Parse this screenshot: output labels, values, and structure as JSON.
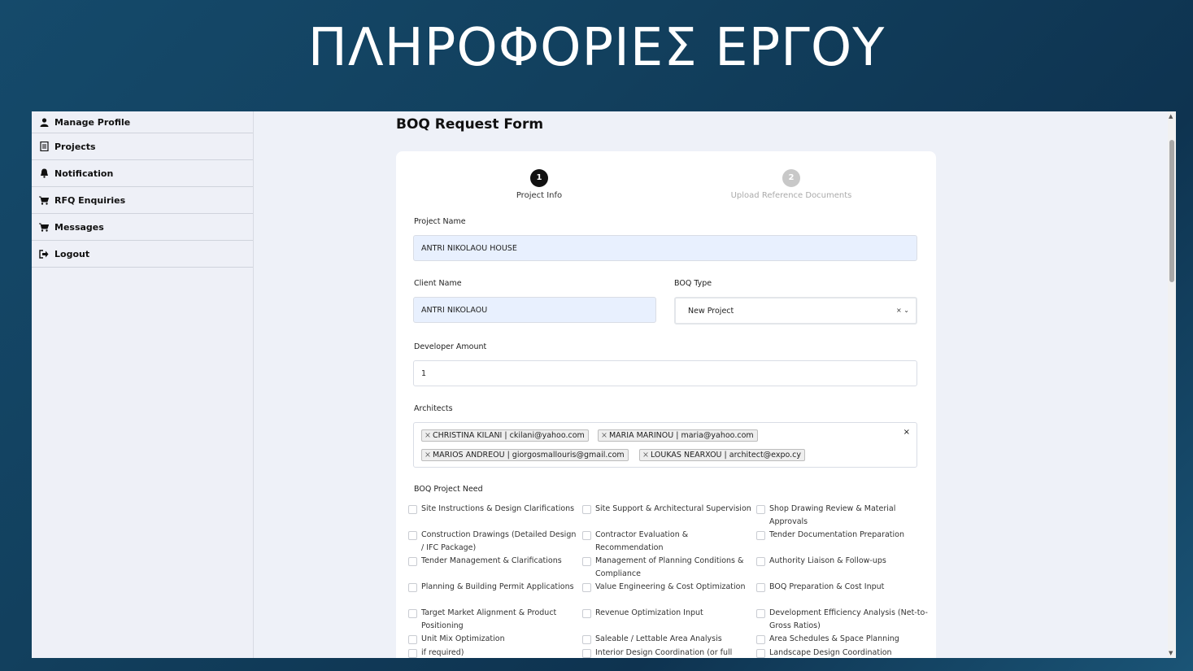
{
  "slide": {
    "title": "ΠΛΗΡΟΦΟΡΙΕΣ ΕΡΓΟΥ"
  },
  "sidebar": {
    "items": [
      {
        "label": "Manage Profile",
        "icon": "user-icon"
      },
      {
        "label": "Projects",
        "icon": "document-icon"
      },
      {
        "label": "Notification",
        "icon": "bell-icon"
      },
      {
        "label": "RFQ Enquiries",
        "icon": "cart-icon"
      },
      {
        "label": "Messages",
        "icon": "cart-icon"
      },
      {
        "label": "Logout",
        "icon": "logout-icon"
      }
    ]
  },
  "form": {
    "title": "BOQ Request Form",
    "steps": [
      {
        "number": "1",
        "label": "Project Info",
        "active": true
      },
      {
        "number": "2",
        "label": "Upload Reference Documents",
        "active": false
      }
    ],
    "project_name": {
      "label": "Project Name",
      "value": "ANTRI NIKOLAOU HOUSE"
    },
    "client_name": {
      "label": "Client Name",
      "value": "ANTRI NIKOLAOU"
    },
    "boq_type": {
      "label": "BOQ Type",
      "value": "New Project"
    },
    "developer_amount": {
      "label": "Developer Amount",
      "value": "1"
    },
    "architects": {
      "label": "Architects",
      "tags": [
        "CHRISTINA KILANI | ckilani@yahoo.com",
        "MARIA MARINOU | maria@yahoo.com",
        "MARIOS ANDREOU | giorgosmallouris@gmail.com",
        "LOUKAS NEARXOU | architect@expo.cy"
      ]
    },
    "project_need": {
      "label": "BOQ Project Need",
      "options": [
        "Site Instructions & Design Clarifications",
        "Site Support & Architectural Supervision",
        "Shop Drawing Review & Material Approvals",
        "Construction Drawings (Detailed Design / IFC Package)",
        "Contractor Evaluation & Recommendation",
        "Tender Documentation Preparation",
        "Tender Management & Clarifications",
        "Management of Planning Conditions & Compliance",
        "Authority Liaison & Follow-ups",
        "Planning & Building Permit Applications",
        "Value Engineering & Cost Optimization",
        "BOQ Preparation & Cost Input",
        "Target Market Alignment & Product Positioning",
        "Revenue Optimization Input",
        "Development Efficiency Analysis (Net-to-Gross Ratios)",
        "Unit Mix Optimization",
        "Saleable / Lettable Area Analysis",
        "Area Schedules & Space Planning",
        "if required)",
        "Interior Design Coordination (or full",
        "Landscape Design Coordination"
      ]
    }
  },
  "colors": {
    "accent": "#111111",
    "inactive_step": "#c8c8c8",
    "filled_input": "#e8f0fe"
  }
}
